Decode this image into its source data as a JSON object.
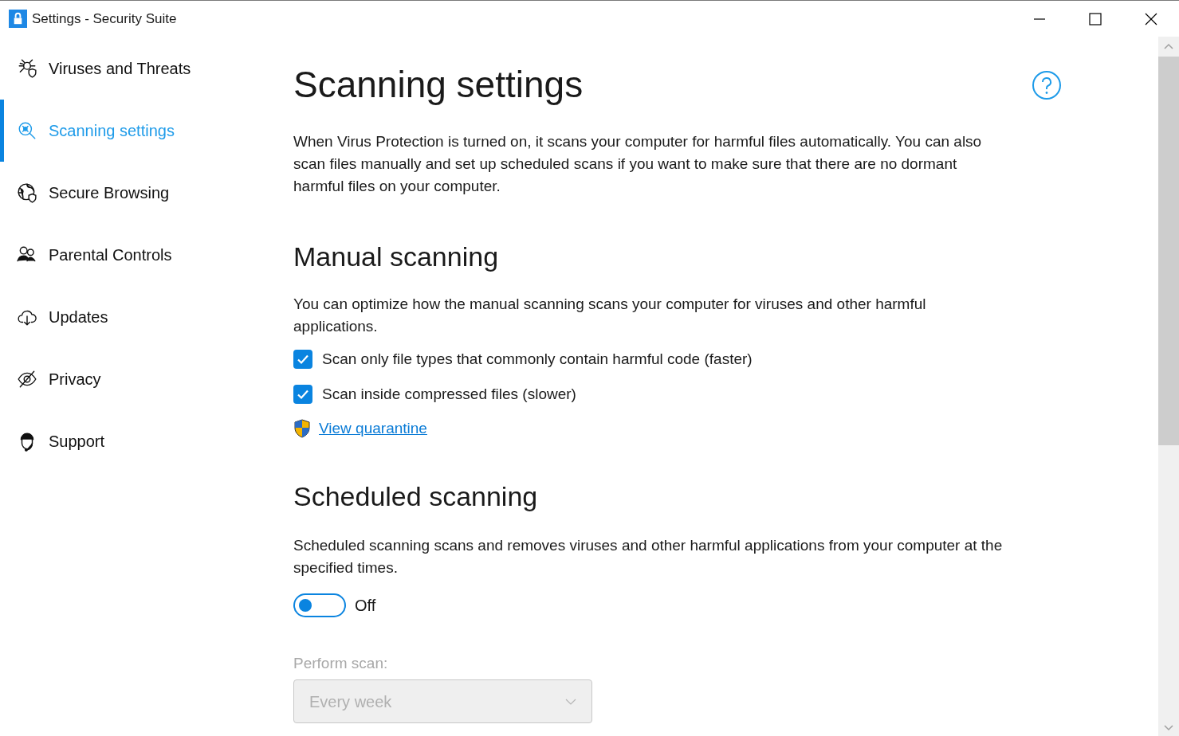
{
  "window": {
    "title": "Settings - Security Suite"
  },
  "sidebar": {
    "items": [
      {
        "label": "Viruses and Threats",
        "selected": false
      },
      {
        "label": "Scanning settings",
        "selected": true
      },
      {
        "label": "Secure Browsing",
        "selected": false
      },
      {
        "label": "Parental Controls",
        "selected": false
      },
      {
        "label": "Updates",
        "selected": false
      },
      {
        "label": "Privacy",
        "selected": false
      },
      {
        "label": "Support",
        "selected": false
      }
    ]
  },
  "page": {
    "title": "Scanning settings",
    "intro": "When Virus Protection is turned on, it scans your computer for harmful files automatically. You can also scan files manually and set up scheduled scans if you want to make sure that there are no dormant harmful files on your computer.",
    "manual": {
      "heading": "Manual scanning",
      "description": "You can optimize how the manual scanning scans your computer for viruses and other harmful applications.",
      "options": [
        {
          "label": "Scan only file types that commonly contain harmful code (faster)",
          "checked": true
        },
        {
          "label": "Scan inside compressed files (slower)",
          "checked": true
        }
      ],
      "link": "View quarantine"
    },
    "scheduled": {
      "heading": "Scheduled scanning",
      "description": "Scheduled scanning scans and removes viruses and other harmful applications from your computer at the specified times.",
      "toggle": {
        "on": false,
        "label": "Off"
      },
      "perform": {
        "label": "Perform scan:",
        "value": "Every week",
        "disabled": true
      }
    }
  }
}
